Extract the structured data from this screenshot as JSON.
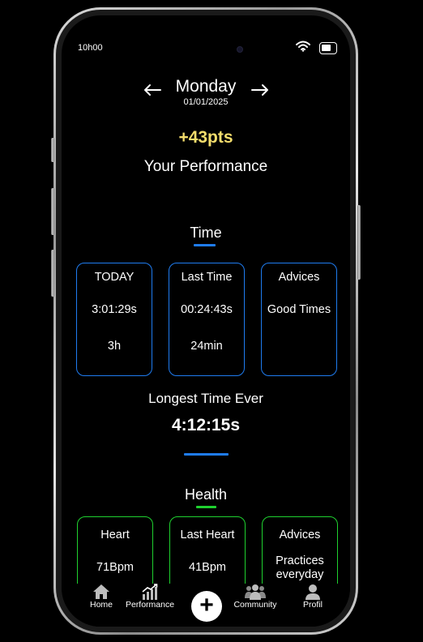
{
  "status_bar": {
    "time": "10h00"
  },
  "header": {
    "day": "Monday",
    "date": "01/01/2025",
    "points": "+43pts",
    "title": "Your Performance"
  },
  "time_section": {
    "title": "Time",
    "accent_color": "#1f7cf0",
    "cards": [
      {
        "title": "TODAY",
        "line1": "3:01:29s",
        "line2": "3h"
      },
      {
        "title": "Last Time",
        "line1": "00:24:43s",
        "line2": "24min"
      },
      {
        "title": "Advices",
        "line1": "Good Times",
        "line2": ""
      }
    ],
    "longest_label": "Longest Time Ever",
    "longest_value": "4:12:15s"
  },
  "health_section": {
    "title": "Health",
    "accent_color": "#1fd12f",
    "cards": [
      {
        "title": "Heart",
        "line1": "71Bpm",
        "line2": ""
      },
      {
        "title": "Last Heart",
        "line1": "41Bpm",
        "line2": ""
      },
      {
        "title": "Advices",
        "line1": "Practices",
        "line2": "everyday"
      }
    ]
  },
  "nav": {
    "items": [
      {
        "label": "Home",
        "icon": "home-icon"
      },
      {
        "label": "Performance",
        "icon": "chart-icon"
      },
      {
        "label": "+",
        "icon": "plus-icon"
      },
      {
        "label": "Community",
        "icon": "community-icon"
      },
      {
        "label": "Profil",
        "icon": "profile-icon"
      }
    ]
  },
  "colors": {
    "points": "#f3dd6c",
    "time_accent": "#1f7cf0",
    "health_accent": "#1fd12f"
  }
}
